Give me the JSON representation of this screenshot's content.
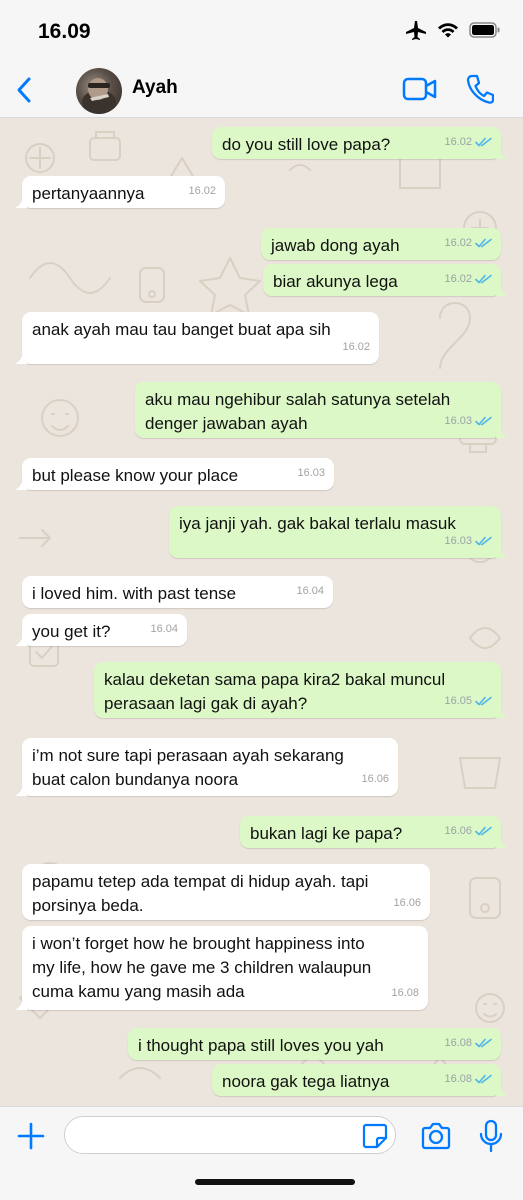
{
  "status_bar": {
    "time": "16.09"
  },
  "header": {
    "contact_name": "Ayah"
  },
  "messages": [
    {
      "dir": "out",
      "text": "do you still love papa?",
      "time": "16.02",
      "read": true
    },
    {
      "dir": "in",
      "text": "pertanyaannya",
      "time": "16.02"
    },
    {
      "dir": "out",
      "text": "jawab dong ayah",
      "time": "16.02",
      "read": true
    },
    {
      "dir": "out",
      "text": "biar akunya lega",
      "time": "16.02",
      "read": true
    },
    {
      "dir": "in",
      "text": "anak ayah mau tau banget buat apa sih",
      "time": "16.02"
    },
    {
      "dir": "out",
      "text": "aku mau ngehibur salah satunya setelah\ndenger jawaban ayah",
      "time": "16.03",
      "read": true
    },
    {
      "dir": "in",
      "text": "but please know your place",
      "time": "16.03"
    },
    {
      "dir": "out",
      "text": "iya janji yah. gak bakal terlalu masuk",
      "time": "16.03",
      "read": true
    },
    {
      "dir": "in",
      "text": "i loved him. with past tense",
      "time": "16.04"
    },
    {
      "dir": "in",
      "text": "you get it?",
      "time": "16.04"
    },
    {
      "dir": "out",
      "text": "kalau deketan sama papa kira2 bakal muncul\nperasaan lagi gak di ayah?",
      "time": "16.05",
      "read": true
    },
    {
      "dir": "in",
      "text": "i’m not sure tapi perasaan ayah sekarang\nbuat calon bundanya noora",
      "time": "16.06"
    },
    {
      "dir": "out",
      "text": "bukan lagi ke papa?",
      "time": "16.06",
      "read": true
    },
    {
      "dir": "in",
      "text": "papamu tetep ada tempat di hidup ayah. tapi\nporsinya beda.",
      "time": "16.06"
    },
    {
      "dir": "in",
      "text": "i won’t forget how he brought happiness into\nmy life, how he gave me 3 children walaupun\ncuma kamu yang masih ada",
      "time": "16.08"
    },
    {
      "dir": "out",
      "text": "i thought papa still loves you yah",
      "time": "16.08",
      "read": true
    },
    {
      "dir": "out",
      "text": "noora gak tega liatnya",
      "time": "16.08",
      "read": true
    }
  ],
  "input": {
    "value": "",
    "placeholder": ""
  },
  "colors": {
    "accent": "#007aff",
    "outgoing_bubble": "#dcf8c6",
    "incoming_bubble": "#ffffff",
    "read_tick": "#4fb6ec"
  }
}
